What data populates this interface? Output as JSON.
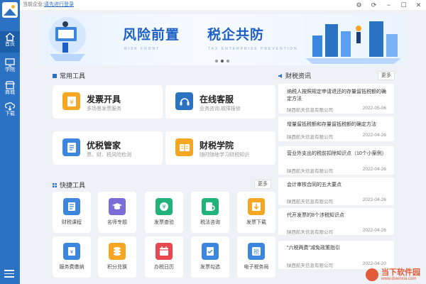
{
  "title_bar": {
    "prefix": "当前企业:",
    "login_link": "请先进行登录"
  },
  "sidebar": {
    "items": [
      {
        "label": "首页"
      },
      {
        "label": "学院"
      },
      {
        "label": "商城"
      },
      {
        "label": "下载"
      }
    ]
  },
  "banner": {
    "title_left": "风险前置",
    "title_right": "税企共防",
    "subtitle_left": "RISK FRONT",
    "subtitle_right": "TAX ENTERPRISE PREVENTION"
  },
  "common_tools": {
    "heading": "常用工具",
    "cards": [
      {
        "title": "发票开具",
        "desc": "多场景发票服务",
        "color": "#f5a623"
      },
      {
        "title": "在线客服",
        "desc": "业务咨询,故障报修",
        "color": "#2b72c2"
      },
      {
        "title": "优税管家",
        "desc": "票、财、税风险检测",
        "color": "#2b72c2"
      },
      {
        "title": "财税学院",
        "desc": "随时随地学习财税知识",
        "color": "#f5a623"
      }
    ]
  },
  "quick_tools": {
    "heading": "快捷工具",
    "more": "更多",
    "items": [
      {
        "label": "财税课程",
        "color": "#3d86e0",
        "icon": "book-icon"
      },
      {
        "label": "名师专题",
        "color": "#7b6cd9",
        "icon": "graduation-cap-icon"
      },
      {
        "label": "发票查验",
        "color": "#21b37a",
        "icon": "yuan-icon"
      },
      {
        "label": "税法咨询",
        "color": "#21b37a",
        "icon": "doc-search-icon"
      },
      {
        "label": "发票下载",
        "color": "#f5a623",
        "icon": "download-icon"
      },
      {
        "label": "服务费缴纳",
        "color": "#3d86e0",
        "icon": "invoice-icon"
      },
      {
        "label": "积分兑换",
        "color": "#f5a623",
        "icon": "coins-icon"
      },
      {
        "label": "办税日历",
        "color": "#e8474f",
        "icon": "calendar-icon"
      },
      {
        "label": "发票勾选",
        "color": "#3d86e0",
        "icon": "check-doc-icon"
      },
      {
        "label": "电子税务局",
        "color": "#3d86e0",
        "icon": "tax-bureau-icon"
      }
    ]
  },
  "news": {
    "heading": "财税资讯",
    "more": "更多",
    "items": [
      {
        "title": "纳税人按照规定申请退还的存量留抵税额的确定方法",
        "source": "陕西航天信息有限公司",
        "date": "2022-05-06"
      },
      {
        "title": "增量留抵税额和存量留抵税额的确定方法",
        "source": "陕西航天信息有限公司",
        "date": "2022-04-26"
      },
      {
        "title": "营业外支出的税前扣除知识点（10个小案例）",
        "source": "陕西航天信息有限公司",
        "date": "2022-04-26"
      },
      {
        "title": "会计审核合同的五大要点",
        "source": "陕西航天信息有限公司",
        "date": "2022-04-26"
      },
      {
        "title": "代开发票的8个涉税知识点",
        "source": "陕西航天信息有限公司",
        "date": "2022-04-26"
      },
      {
        "title": "\"六税两费\"减免政策指引",
        "source": "陕西航天信息有限公司",
        "date": "2022-04-20"
      }
    ]
  },
  "watermark": {
    "name": "当下软件园",
    "url": "www.downxia.com"
  }
}
